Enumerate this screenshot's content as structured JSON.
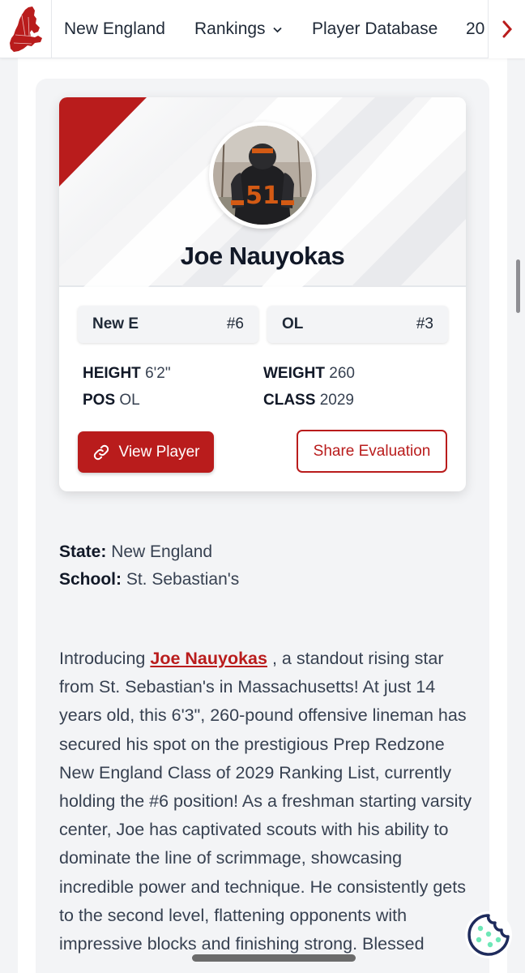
{
  "nav": {
    "items": [
      {
        "label": "New England"
      },
      {
        "label": "Rankings"
      },
      {
        "label": "Player Database"
      },
      {
        "label": "20"
      }
    ]
  },
  "player": {
    "name": "Joe Nauyokas",
    "jersey_number": "51",
    "state_rank": {
      "label": "New E",
      "value": "#6"
    },
    "position_rank": {
      "label": "OL",
      "value": "#3"
    },
    "stats": {
      "height": {
        "label": "HEIGHT",
        "value": "6'2\""
      },
      "weight": {
        "label": "WEIGHT",
        "value": "260"
      },
      "pos": {
        "label": "POS",
        "value": "OL"
      },
      "class": {
        "label": "CLASS",
        "value": "2029"
      }
    },
    "buttons": {
      "view": "View Player",
      "share": "Share Evaluation"
    }
  },
  "info": {
    "state_label": "State:",
    "state_value": "New England",
    "school_label": "School:",
    "school_value": "St. Sebastian's"
  },
  "article": {
    "intro": "Introducing",
    "link_text": "Joe Nauyokas",
    "body": ", a standout rising star from St. Sebastian's in Massachusetts! At just 14 years old, this 6'3\", 260-pound offensive lineman has secured his spot on the prestigious Prep Redzone New England Class of 2029 Ranking List, currently holding the #6 position! As a freshman starting varsity center, Joe has captivated scouts with his ability to dominate the line of scrimmage, showcasing incredible power and technique. He consistently gets to the second level, flattening opponents with impressive blocks and finishing strong. Blessed"
  },
  "colors": {
    "brand_red": "#b91c1c",
    "cookie_navy": "#1e2b5c",
    "cookie_green": "#6ee7b7"
  },
  "icons": [
    "new-england-logo-icon",
    "chevron-down-icon",
    "chevron-right-icon",
    "link-icon",
    "cookie-icon"
  ]
}
